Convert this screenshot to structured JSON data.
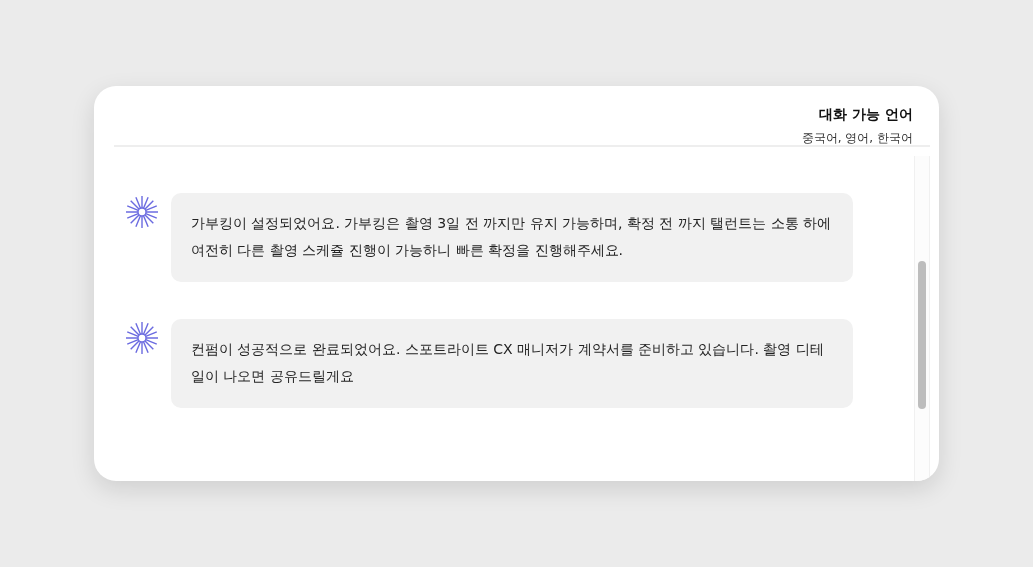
{
  "header": {
    "title": "대화 가능 언어",
    "languages": "중국어, 영어, 한국어"
  },
  "messages": [
    {
      "text": "가부킹이 설정되었어요. 가부킹은 촬영 3일 전 까지만 유지 가능하며, 확정 전 까지 탤런트는 소통 하에 여전히 다른 촬영 스케쥴 진행이 가능하니 빠른 확정을 진행해주세요."
    },
    {
      "text": "컨펌이 성공적으로 완료되었어요. 스포트라이트 CX 매니저가 계약서를 준비하고 있습니다. 촬영 디테일이 나오면 공유드릴게요"
    }
  ]
}
